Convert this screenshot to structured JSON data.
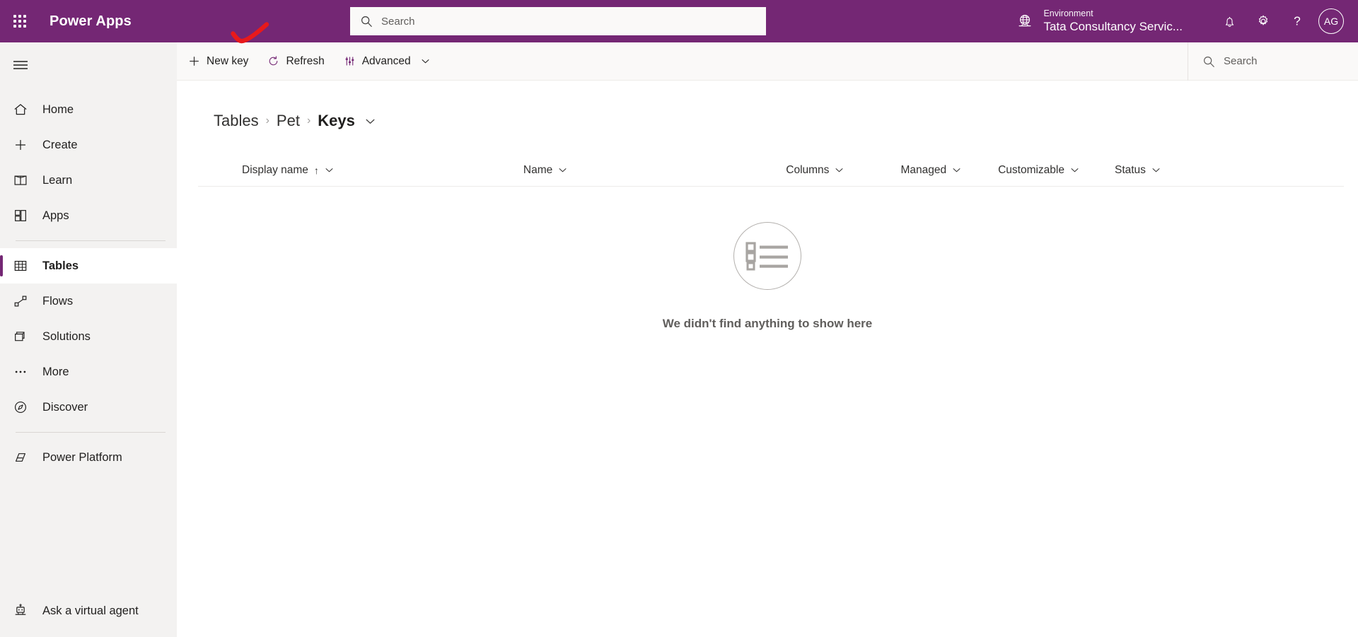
{
  "header": {
    "waffle_label": "App launcher",
    "brand": "Power Apps",
    "search": {
      "placeholder": "Search",
      "value": ""
    },
    "environment": {
      "label": "Environment",
      "name": "Tata Consultancy Servic..."
    },
    "icons": {
      "notifications": "bell-icon",
      "settings": "gear-icon",
      "help": "help-icon"
    },
    "avatar_initials": "AG",
    "brand_color": "#742774",
    "annotation_color": "#e8191b"
  },
  "sidebar": {
    "toggle": "hamburger-menu",
    "items": [
      {
        "label": "Home",
        "icon": "home-icon",
        "selected": false
      },
      {
        "label": "Create",
        "icon": "plus-icon",
        "selected": false
      },
      {
        "label": "Learn",
        "icon": "book-icon",
        "selected": false
      },
      {
        "label": "Apps",
        "icon": "apps-grid-icon",
        "selected": false
      },
      {
        "label": "Tables",
        "icon": "table-icon",
        "selected": true
      },
      {
        "label": "Flows",
        "icon": "flow-icon",
        "selected": false
      },
      {
        "label": "Solutions",
        "icon": "solutions-icon",
        "selected": false
      },
      {
        "label": "More",
        "icon": "ellipsis-icon",
        "selected": false
      },
      {
        "label": "Discover",
        "icon": "compass-icon",
        "selected": false
      },
      {
        "label": "Power Platform",
        "icon": "power-platform-icon",
        "selected": false
      }
    ],
    "bottom_item": {
      "label": "Ask a virtual agent",
      "icon": "robot-icon"
    },
    "selected_accent": "#742774"
  },
  "command_bar": {
    "new_key": "New key",
    "refresh": "Refresh",
    "advanced": "Advanced",
    "search": {
      "placeholder": "Search",
      "value": ""
    }
  },
  "breadcrumb": {
    "tables": "Tables",
    "separator": "›",
    "entity": "Pet",
    "current": "Keys"
  },
  "grid": {
    "columns": [
      {
        "label": "Display name",
        "sorted": true,
        "sort_direction": "↑"
      },
      {
        "label": "Name",
        "sorted": false,
        "sort_direction": ""
      },
      {
        "label": "Columns",
        "sorted": false,
        "sort_direction": ""
      },
      {
        "label": "Managed",
        "sorted": false,
        "sort_direction": ""
      },
      {
        "label": "Customizable",
        "sorted": false,
        "sort_direction": ""
      },
      {
        "label": "Status",
        "sorted": false,
        "sort_direction": ""
      }
    ],
    "rows": [],
    "empty_state": {
      "icon": "list-placeholder-icon",
      "message": "We didn't find anything to show here"
    }
  }
}
